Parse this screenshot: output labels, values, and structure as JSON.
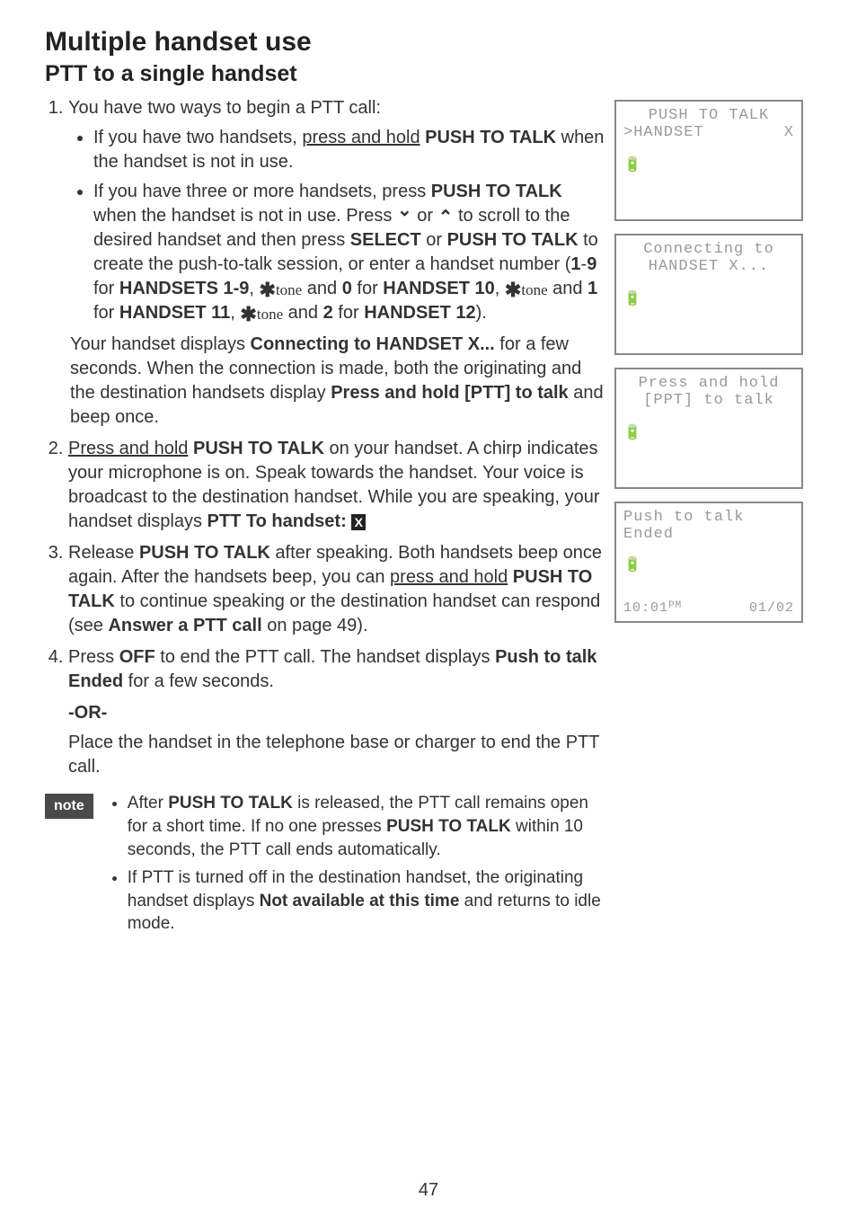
{
  "headings": {
    "h1": "Multiple handset use",
    "h2": "PTT to a single handset"
  },
  "steps": {
    "s1_intro": "You have two ways to begin a PTT call:",
    "s1_b1_pre": "If you have two handsets, ",
    "s1_b1_under": "press and hold",
    "s1_b1_bold": " PUSH TO TALK",
    "s1_b1_post": " when the handset is not in use.",
    "s1_b2_a": "If you have three or more handsets, press ",
    "s1_b2_ptt": "PUSH TO TALK",
    "s1_b2_b": " when the handset is not in use. Press ",
    "s1_b2_c": " or ",
    "s1_b2_d": " to scroll to the desired handset and then press ",
    "s1_b2_select": "SELECT",
    "s1_b2_or": " or ",
    "s1_b2_ptt2": "PUSH TO TALK",
    "s1_b2_e": " to create the push-to-talk session, or enter a handset number (",
    "s1_b2_19": "1",
    "s1_b2_dash": "-",
    "s1_b2_9": "9",
    "s1_b2_for": " for ",
    "s1_b2_h19": "HANDSETS 1-9",
    "s1_b2_comma": ", ",
    "s1_b2_and0": " and ",
    "s1_b2_0": "0",
    "s1_b2_for2": " for ",
    "s1_b2_h10": "HANDSET 10",
    "s1_b2_comma2": ", ",
    "s1_b2_and1": " and ",
    "s1_b2_1": "1",
    "s1_b2_for3": " for ",
    "s1_b2_h11": "HANDSET 11",
    "s1_b2_comma3": ", ",
    "s1_b2_and2": " and ",
    "s1_b2_2": "2",
    "s1_b2_for4": " for ",
    "s1_b2_h12": "HANDSET 12",
    "s1_b2_close": ").",
    "s1_para_a": "Your handset displays ",
    "s1_para_bold": "Connecting to HANDSET X...",
    "s1_para_b": " for a few seconds. When the connection is made, both the originating and the destination handsets display ",
    "s1_para_bold2": "Press and hold [PTT] to talk",
    "s1_para_c": " and beep once.",
    "s2_under": "Press and hold",
    "s2_ptt": " PUSH TO TALK",
    "s2_a": " on your handset. A chirp indicates your microphone is on. Speak towards the handset. Your voice is broadcast to the destination handset. While you are speaking, your handset displays ",
    "s2_bold": "PTT To handset: ",
    "s3_a": "Release ",
    "s3_ptt": "PUSH TO TALK",
    "s3_b": " after speaking. Both handsets beep once again. After the handsets beep, you can ",
    "s3_under": "press and hold",
    "s3_ptt2": " PUSH TO TALK",
    "s3_c": " to continue speaking or the destination handset can respond (see ",
    "s3_bold": "Answer a PTT call",
    "s3_d": " on page 49).",
    "s4_a": "Press ",
    "s4_off": "OFF",
    "s4_b": " to end the PTT call. The handset displays ",
    "s4_bold": "Push to talk Ended",
    "s4_c": " for a few seconds."
  },
  "or_label": "-OR-",
  "or_text": "Place the handset in the telephone base or charger to end the PTT call.",
  "note_badge": "note",
  "notes": {
    "n1_a": "After ",
    "n1_ptt": "PUSH TO TALK",
    "n1_b": " is released, the PTT call remains open for a short time. If no one presses ",
    "n1_ptt2": "PUSH TO TALK",
    "n1_c": " within 10 seconds, the PTT call ends automatically.",
    "n2_a": "If PTT is turned off in the destination handset, the originating handset displays ",
    "n2_bold": "Not available at this time",
    "n2_b": " and returns to idle mode."
  },
  "tone_word": "tone",
  "lcd": {
    "l1_line1": "PUSH TO TALK",
    "l1_line2_left": ">HANDSET",
    "l1_line2_right": "X",
    "l2_line1": "Connecting to",
    "l2_line2": "HANDSET X...",
    "l3_line1": "Press and hold",
    "l3_line2": "[PPT] to talk",
    "l4_line1": "Push to talk",
    "l4_line2": "Ended",
    "l4_time": "10:01",
    "l4_ampm": "PM",
    "l4_date": "01/02",
    "battery_glyph": "🔋"
  },
  "page_number": "47"
}
